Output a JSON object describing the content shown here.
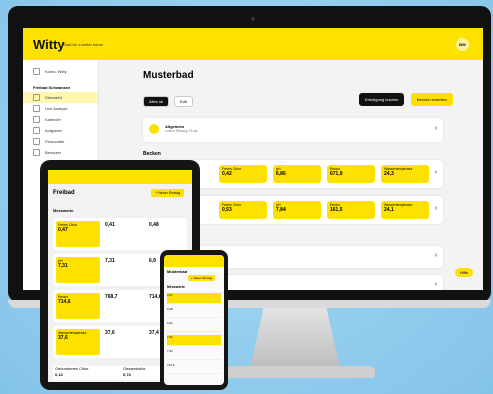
{
  "app": {
    "logo": "Witty",
    "tagline": "Start for a better future",
    "avatar": "BW"
  },
  "sidebar": {
    "account": "Konto: Witty",
    "section": "Freibad Schwansee",
    "items": [
      "Übersicht",
      "Live Analyse",
      "Kalender",
      "Aufgaben",
      "Personaler",
      "Benutzer",
      "",
      "",
      "",
      ""
    ]
  },
  "main": {
    "title": "Musterbad",
    "chips": [
      "Alles ok",
      "Edit"
    ],
    "btn_primary": "Erledigung buchen",
    "btn_secondary": "Bereich erstellen",
    "general_card": {
      "title": "Allgemein",
      "subtitle": "Lorem Strassg 15 ab"
    },
    "section_basins": "Becken",
    "basins": [
      {
        "title": "Kinderbecken",
        "subtitle": "Letzter Eintrag: 12.0",
        "metrics": [
          {
            "label": "Freies Chlor",
            "value": "0,42"
          },
          {
            "label": "pH",
            "value": "6,86"
          },
          {
            "label": "Redox",
            "value": "671,9"
          },
          {
            "label": "Wassertemperatur",
            "value": "24,3"
          }
        ]
      },
      {
        "title": "",
        "subtitle": "",
        "metrics": [
          {
            "label": "Freies Chlor",
            "value": "0,53"
          },
          {
            "label": "pH",
            "value": "7,84"
          },
          {
            "label": "Redox",
            "value": "161,5"
          },
          {
            "label": "Wassertemperatur",
            "value": "24,1"
          }
        ]
      }
    ],
    "help": "Hilfe"
  },
  "tablet": {
    "title": "Freibad",
    "button": "+ Neuer Eintrag",
    "section": "Messwerte",
    "rows": [
      {
        "main_label": "Freies Chlor",
        "main_value": "0,47",
        "values": [
          "0,41",
          "0,48"
        ]
      },
      {
        "main_label": "pH",
        "main_value": "7,31",
        "values": [
          "7,31",
          "6,9"
        ]
      },
      {
        "main_label": "Redox",
        "main_value": "714,6",
        "values": [
          "768,7",
          "714,6"
        ]
      },
      {
        "main_label": "Wassertemperatur",
        "main_value": "37,6",
        "values": [
          "37,6",
          "37,4"
        ]
      }
    ],
    "bottom": [
      "Gebundenes Chlor",
      "0,14",
      "Gesamtchlor",
      "0,74"
    ]
  },
  "phone": {
    "title": "Musterbad",
    "button": "+ Neuer Eintrag",
    "section": "Messwerte",
    "rows": [
      "0,47",
      "0,48",
      "0,41",
      "7,31",
      "7,31",
      "714,6",
      "768,7"
    ]
  }
}
